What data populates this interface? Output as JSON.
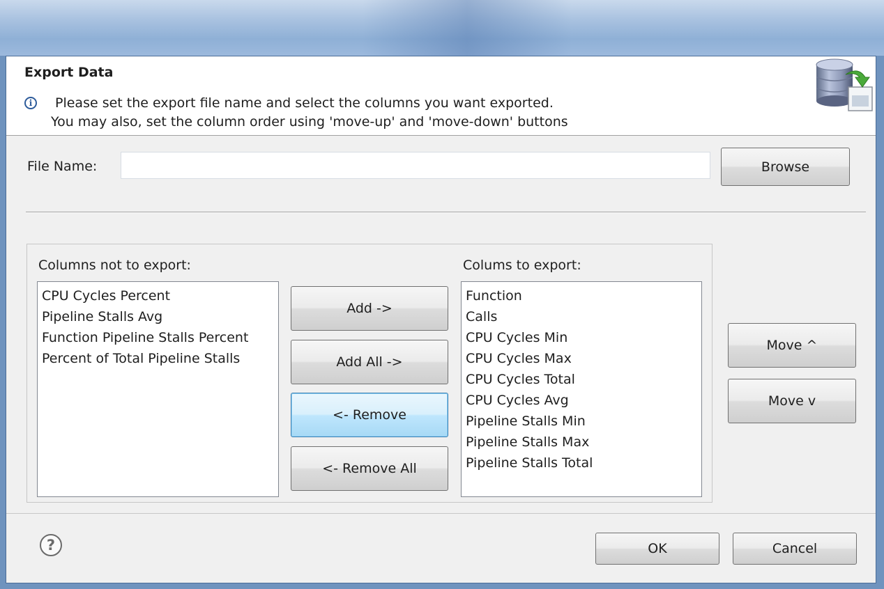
{
  "header": {
    "title": "Export Data",
    "message_line1": "Please set the export file name and select the columns you want exported.",
    "message_line2": "You may also, set the column order using 'move-up' and 'move-down' buttons"
  },
  "file": {
    "label": "File Name:",
    "value": "",
    "browse_label": "Browse"
  },
  "left_list": {
    "label": "Columns not to export:",
    "items": [
      "CPU Cycles Percent",
      "Pipeline Stalls Avg",
      "Function Pipeline Stalls Percent",
      "Percent of Total Pipeline Stalls"
    ]
  },
  "right_list": {
    "label": "Colums to export:",
    "items": [
      "Function",
      "Calls",
      "CPU Cycles Min",
      "CPU Cycles Max",
      "CPU Cycles Total",
      "CPU Cycles Avg",
      "Pipeline Stalls Min",
      "Pipeline Stalls Max",
      "Pipeline Stalls Total"
    ]
  },
  "transfer": {
    "add": "Add ->",
    "add_all": "Add All ->",
    "remove": "<- Remove",
    "remove_all": "<- Remove All"
  },
  "order": {
    "move_up": "Move ^",
    "move_down": "Move v"
  },
  "footer": {
    "ok": "OK",
    "cancel": "Cancel"
  }
}
